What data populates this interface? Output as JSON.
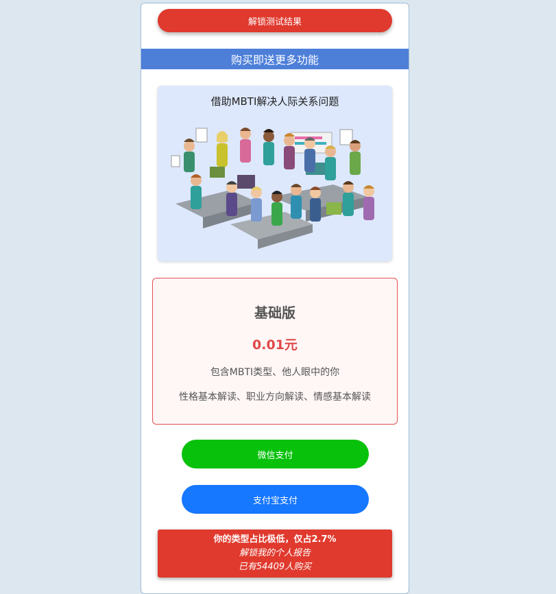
{
  "top_button": {
    "label": "解锁测试结果"
  },
  "banner": {
    "text": "购买即送更多功能"
  },
  "feature": {
    "title": "借助MBTI解决人际关系问题",
    "image": "office-team-illustration"
  },
  "plan": {
    "name": "基础版",
    "price": "0.01元",
    "desc_line1": "包含MBTI类型、他人眼中的你",
    "desc_line2": "性格基本解读、职业方向解读、情感基本解读"
  },
  "payment": {
    "wechat_label": "微信支付",
    "alipay_label": "支付宝支付"
  },
  "promo": {
    "line1": "你的类型占比极低，仅占2.7%",
    "line2": "解锁我的个人报告",
    "line3": "已有54409人购买"
  },
  "colors": {
    "accent_red": "#e0392d",
    "banner_blue": "#4d7fd9",
    "wechat_green": "#07c10b",
    "alipay_blue": "#1677ff",
    "price_red": "#e04848"
  }
}
